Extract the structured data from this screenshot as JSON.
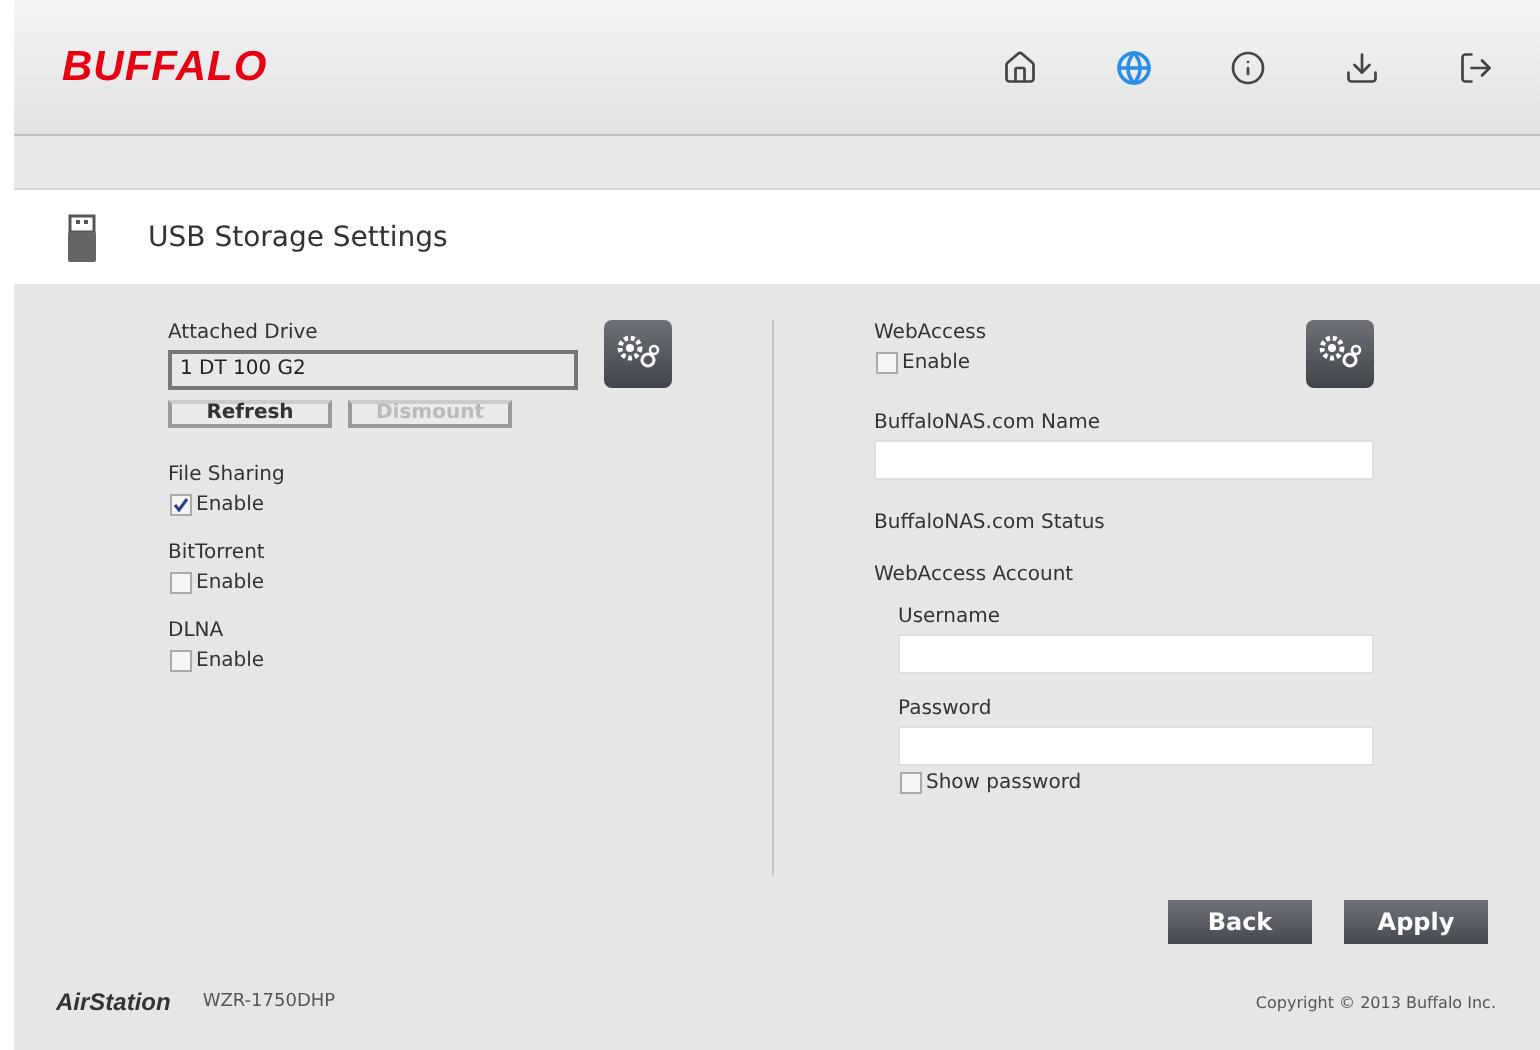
{
  "header": {
    "logo": "BUFFALO",
    "nav": [
      {
        "kind": "home",
        "selected": false
      },
      {
        "kind": "globe",
        "selected": true
      },
      {
        "kind": "info",
        "selected": false
      },
      {
        "kind": "download",
        "selected": false
      },
      {
        "kind": "logout",
        "selected": false
      }
    ]
  },
  "page_title": "USB Storage Settings",
  "left": {
    "attached_drive": {
      "label": "Attached Drive",
      "value": "1 DT 100 G2"
    },
    "buttons": [
      {
        "label": "Refresh",
        "disabled": false
      },
      {
        "label": "Dismount",
        "disabled": true
      }
    ],
    "options": [
      {
        "label": "File Sharing",
        "checkbox": "Enable",
        "checked": true
      },
      {
        "label": "BitTorrent",
        "checkbox": "Enable",
        "checked": false
      },
      {
        "label": "DLNA",
        "checkbox": "Enable",
        "checked": false
      }
    ]
  },
  "right": {
    "webaccess": {
      "label": "WebAccess",
      "checkbox": "Enable",
      "checked": false
    },
    "name_label": "BuffaloNAS.com Name",
    "status_label": "BuffaloNAS.com Status",
    "account_label": "WebAccess Account",
    "username_label": "Username",
    "password_label": "Password",
    "show_password": {
      "label": "Show password",
      "checked": false
    }
  },
  "actions": [
    "Back",
    "Apply"
  ],
  "footer": {
    "brand": "AirStation",
    "model": "WZR-1750DHP",
    "copyright": "Copyright © 2013 Buffalo Inc."
  }
}
